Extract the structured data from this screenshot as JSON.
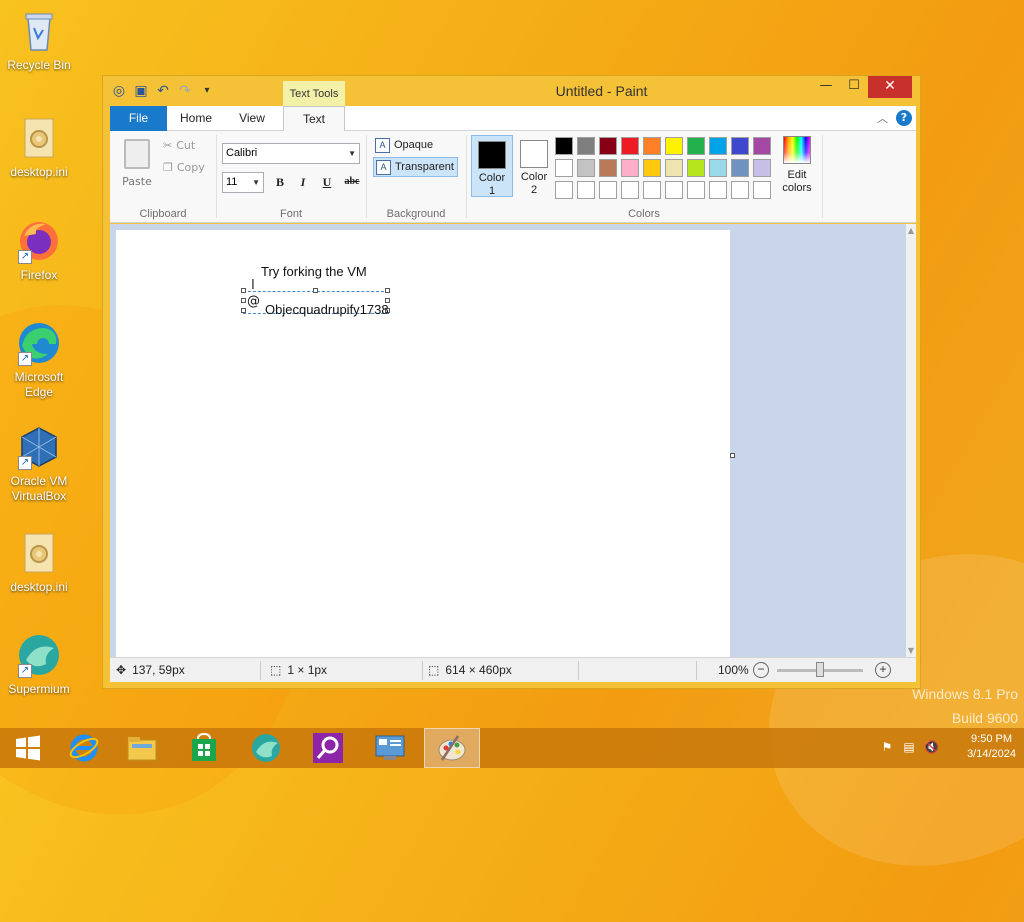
{
  "desktop": {
    "icons": [
      {
        "label": "Recycle Bin"
      },
      {
        "label": "desktop.ini"
      },
      {
        "label": "Firefox"
      },
      {
        "label": "Microsoft Edge"
      },
      {
        "label": "Oracle VM VirtualBox"
      },
      {
        "label": "desktop.ini"
      },
      {
        "label": "Supermium"
      }
    ],
    "watermark_line1": "Windows 8.1 Pro",
    "watermark_line2": "Build 9600"
  },
  "window": {
    "title": "Untitled - Paint",
    "contextual_tab": "Text Tools"
  },
  "tabs": {
    "file": "File",
    "home": "Home",
    "view": "View",
    "text": "Text"
  },
  "ribbon": {
    "clipboard": {
      "paste": "Paste",
      "cut": "Cut",
      "copy": "Copy",
      "label": "Clipboard"
    },
    "font": {
      "family": "Calibri",
      "size": "11",
      "bold": "B",
      "italic": "I",
      "underline": "U",
      "strike": "abc",
      "label": "Font"
    },
    "background": {
      "opaque": "Opaque",
      "transparent": "Transparent",
      "label": "Background"
    },
    "colors": {
      "color1": "Color 1",
      "color2": "Color 2",
      "edit": "Edit colors",
      "label": "Colors",
      "color1_value": "#000000",
      "color2_value": "#ffffff",
      "palette": [
        "#000000",
        "#7f7f7f",
        "#880015",
        "#ed1c24",
        "#ff7f27",
        "#fff200",
        "#22b14c",
        "#00a2e8",
        "#3f48cc",
        "#a349a4",
        "#ffffff",
        "#c3c3c3",
        "#b97a57",
        "#ffaec9",
        "#ffc90e",
        "#efe4b0",
        "#b5e61d",
        "#99d9ea",
        "#7092be",
        "#c8bfe7",
        "#ffffff",
        "#ffffff",
        "#ffffff",
        "#ffffff",
        "#ffffff",
        "#ffffff",
        "#ffffff",
        "#ffffff",
        "#ffffff",
        "#ffffff"
      ]
    }
  },
  "canvas": {
    "line1": "Try forking the  VM",
    "line2": "Objecquadrupify1738",
    "cursor_char": "@"
  },
  "status": {
    "position": "137, 59px",
    "selection": "1 × 1px",
    "size": "614 × 460px",
    "zoom": "100%"
  },
  "taskbar": {
    "time": "9:50 PM",
    "date": "3/14/2024"
  }
}
